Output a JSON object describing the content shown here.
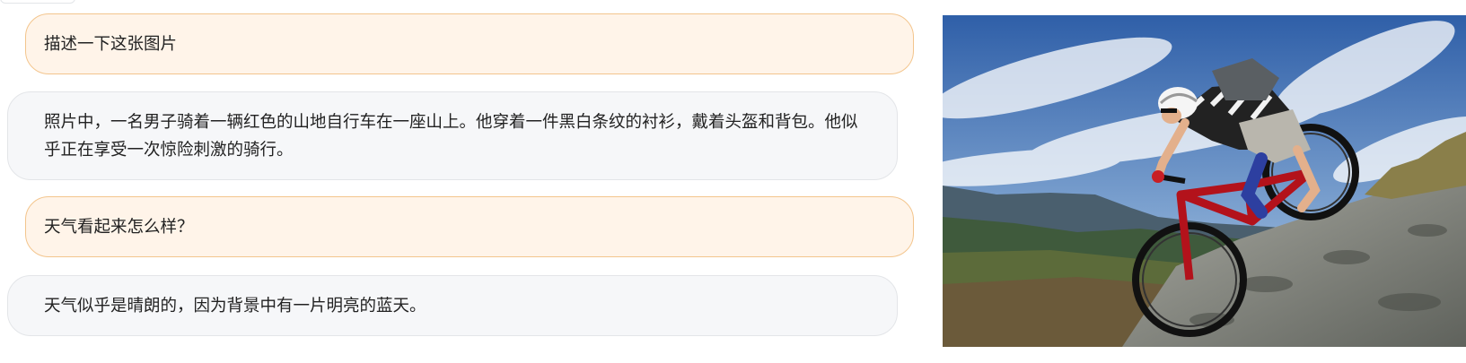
{
  "conversation": {
    "messages": [
      {
        "role": "user",
        "text": "描述一下这张图片"
      },
      {
        "role": "assistant",
        "text": "照片中，一名男子骑着一辆红色的山地自行车在一座山上。他穿着一件黑白条纹的衬衫，戴着头盔和背包。他似乎正在享受一次惊险刺激的骑行。"
      },
      {
        "role": "user",
        "text": "天气看起来怎么样？"
      },
      {
        "role": "assistant",
        "text": "天气似乎是晴朗的，因为背景中有一片明亮的蓝天。"
      }
    ]
  },
  "image": {
    "icon": "mountain-biker-photo",
    "colors": {
      "sky": "#3c6bb0",
      "hills": "#3f5a3c",
      "rock": "#8c8f88",
      "bike_frame": "#b3121b"
    }
  }
}
